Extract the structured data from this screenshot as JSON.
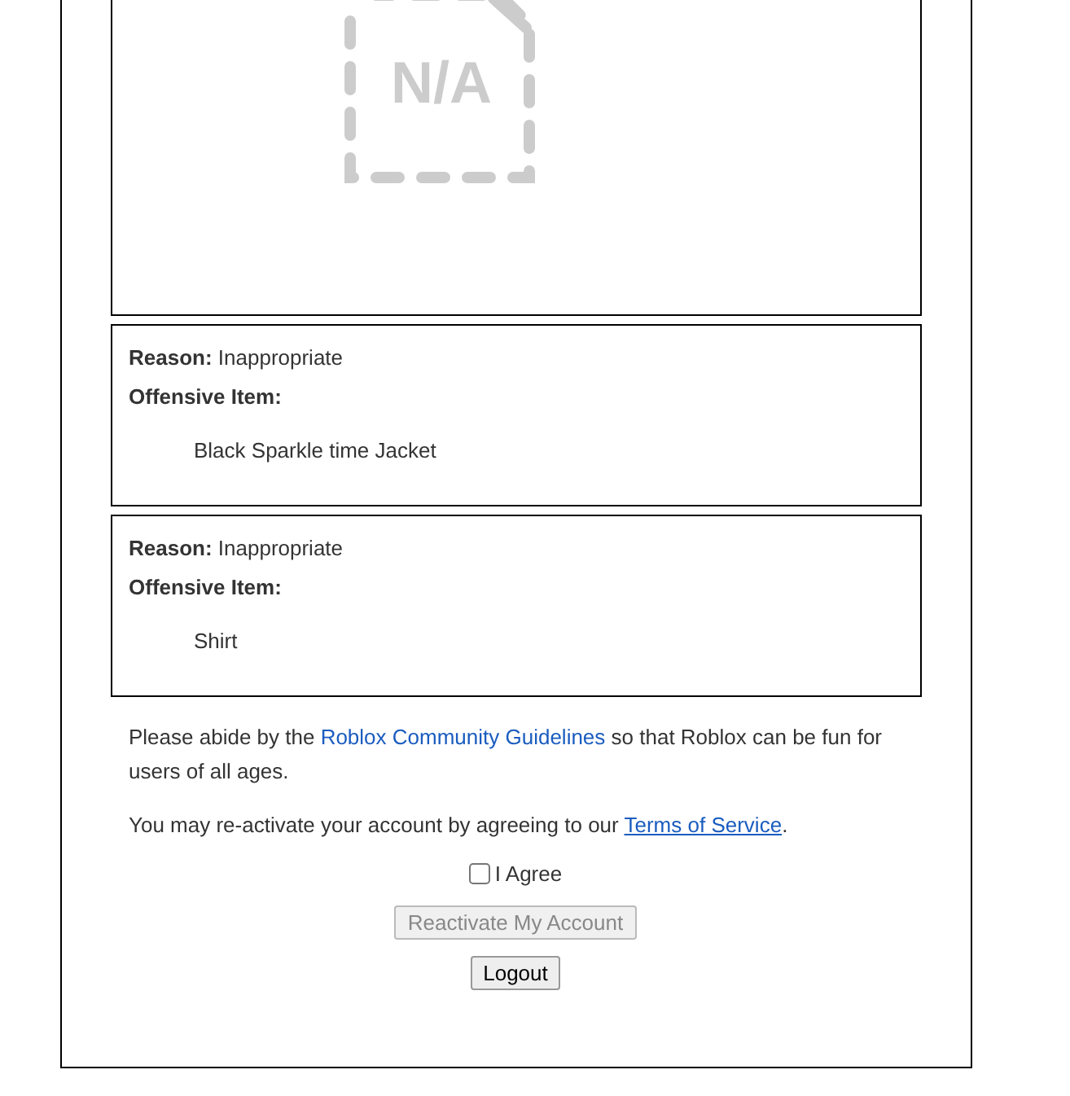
{
  "thumbnail": {
    "kind": "placeholder",
    "placeholder_label": "N/A"
  },
  "violations": [
    {
      "reason": "**Reason:** Inappropriate",
      "item_label": "Offensive Item:",
      "item": "Black Sparkle time Jacket"
    },
    {
      "reason": "**Reason:** Inappropriate",
      "item_label": "Offensive Item:",
      "item": "Shirt"
    }
  ],
  "guidelines": {
    "before": "Please abide by the",
    "link": "Roblox Community Guidelines",
    "after": "so that Roblox can be fun for users of all ages."
  },
  "terms": {
    "before": "You may re-activate your account by agreeing to our",
    "link": "Terms of Service",
    "after": "."
  },
  "agree": {
    "label": "I Agree",
    "checked": false
  },
  "reactivate_button": {
    "label": "Reactivate My Account",
    "disabled": true
  },
  "logout_button": {
    "label": "Logout"
  }
}
